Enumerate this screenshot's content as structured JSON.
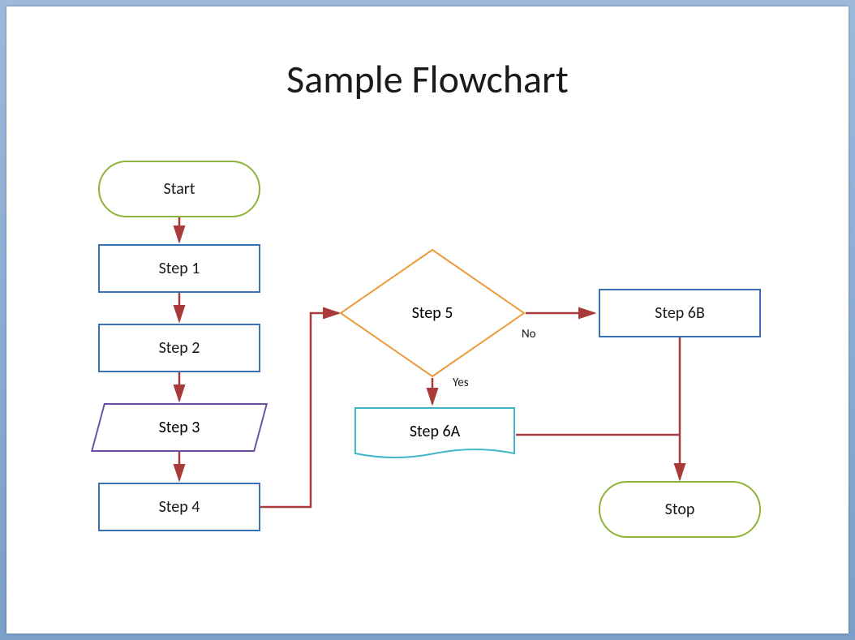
{
  "title": "Sample Flowchart",
  "nodes": {
    "start": "Start",
    "step1": "Step 1",
    "step2": "Step 2",
    "step3": "Step 3",
    "step4": "Step 4",
    "step5": "Step 5",
    "step6a": "Step 6A",
    "step6b": "Step 6B",
    "stop": "Stop"
  },
  "edges": {
    "no": "No",
    "yes": "Yes"
  },
  "colors": {
    "terminator": "#8db33a",
    "process": "#3a6fb5",
    "data": "#6b4d9e",
    "decision": "#ed9a3a",
    "document": "#3fb7c9",
    "connector": "#a83a3a"
  }
}
